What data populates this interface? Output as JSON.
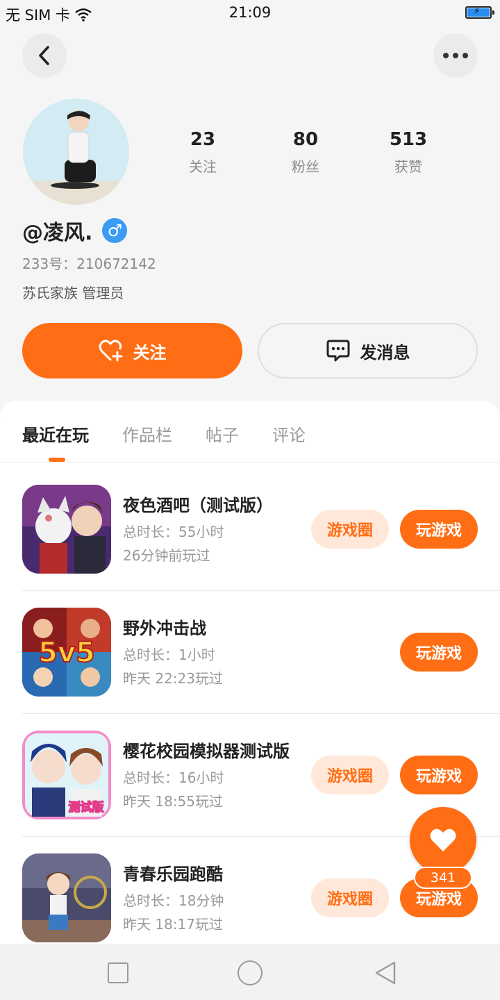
{
  "status_bar": {
    "carrier": "无 SIM 卡",
    "time": "21:09"
  },
  "profile": {
    "username": "@凌风.",
    "gender_symbol": "♂",
    "uid_line": "233号：210672142",
    "title_line": "苏氏家族 管理员",
    "stats": [
      {
        "num": "23",
        "label": "关注"
      },
      {
        "num": "80",
        "label": "粉丝"
      },
      {
        "num": "513",
        "label": "获赞"
      }
    ]
  },
  "actions": {
    "follow_label": "关注",
    "message_label": "发消息"
  },
  "tabs": [
    "最近在玩",
    "作品栏",
    "帖子",
    "评论"
  ],
  "games": [
    {
      "name": "夜色酒吧（测试版）",
      "duration": "总时长：55小时",
      "last_played": "26分钟前玩过",
      "circle_label": "游戏圈",
      "play_label": "玩游戏"
    },
    {
      "name": "野外冲击战",
      "duration": "总时长：1小时",
      "last_played": "昨天 22:23玩过",
      "play_label": "玩游戏",
      "icon_text": "5v5"
    },
    {
      "name": "樱花校园模拟器测试版",
      "duration": "总时长：16小时",
      "last_played": "昨天 18:55玩过",
      "circle_label": "游戏圈",
      "play_label": "玩游戏",
      "icon_text": "测试版"
    },
    {
      "name": "青春乐园跑酷",
      "duration": "总时长：18分钟",
      "last_played": "昨天 18:17玩过",
      "circle_label": "游戏圈",
      "play_label": "玩游戏"
    }
  ],
  "fab": {
    "count": "341"
  },
  "colors": {
    "accent": "#ff6e14",
    "accent_light": "#ffe8d9",
    "gender_blue": "#3a9bf2"
  }
}
